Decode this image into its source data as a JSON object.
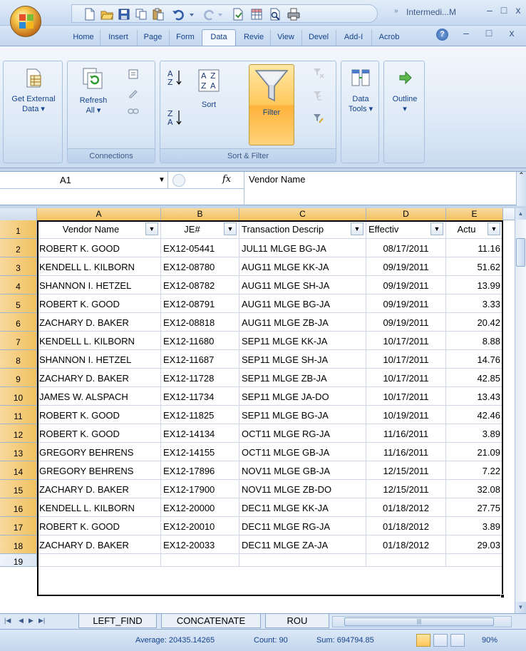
{
  "window": {
    "title": "Intermedi...M",
    "qat_more": "»",
    "min": "–",
    "max": "□",
    "close": "x"
  },
  "ribbon_tabs": [
    "Home",
    "Insert",
    "Page",
    "Form",
    "Data",
    "Revie",
    "View",
    "Devel",
    "Add-I",
    "Acrob"
  ],
  "active_tab": "Data",
  "ribbon": {
    "get_external_data": "Get External",
    "get_external_data_2": "Data",
    "refresh": "Refresh",
    "refresh_2": "All",
    "connections_label": "Connections",
    "sort": "Sort",
    "filter": "Filter",
    "sort_filter_label": "Sort & Filter",
    "data_tools": "Data",
    "data_tools_2": "Tools",
    "outline": "Outline"
  },
  "formula_bar": {
    "name_box": "A1",
    "fx": "fx",
    "value": "Vendor Name"
  },
  "columns": [
    "A",
    "B",
    "C",
    "D",
    "E"
  ],
  "headers": [
    "Vendor Name",
    "JE#",
    "Transaction Descrip",
    "Effectiv",
    "Actu"
  ],
  "rows": [
    [
      "ROBERT K. GOOD",
      "EX12-05441",
      "JUL11 MLGE BG-JA",
      "08/17/2011",
      "11.16"
    ],
    [
      "KENDELL L. KILBORN",
      "EX12-08780",
      "AUG11 MLGE KK-JA",
      "09/19/2011",
      "51.62"
    ],
    [
      "SHANNON I. HETZEL",
      "EX12-08782",
      "AUG11 MLGE SH-JA",
      "09/19/2011",
      "13.99"
    ],
    [
      "ROBERT K. GOOD",
      "EX12-08791",
      "AUG11 MLGE BG-JA",
      "09/19/2011",
      "3.33"
    ],
    [
      "ZACHARY D. BAKER",
      "EX12-08818",
      "AUG11 MLGE ZB-JA",
      "09/19/2011",
      "20.42"
    ],
    [
      "KENDELL L. KILBORN",
      "EX12-11680",
      "SEP11 MLGE KK-JA",
      "10/17/2011",
      "8.88"
    ],
    [
      "SHANNON I. HETZEL",
      "EX12-11687",
      "SEP11 MLGE SH-JA",
      "10/17/2011",
      "14.76"
    ],
    [
      "ZACHARY D. BAKER",
      "EX12-11728",
      "SEP11 MLGE ZB-JA",
      "10/17/2011",
      "42.85"
    ],
    [
      "JAMES W. ALSPACH",
      "EX12-11734",
      "SEP11 MLGE JA-DO",
      "10/17/2011",
      "13.43"
    ],
    [
      "ROBERT K. GOOD",
      "EX12-11825",
      "SEP11 MLGE BG-JA",
      "10/19/2011",
      "42.46"
    ],
    [
      "ROBERT K. GOOD",
      "EX12-14134",
      "OCT11 MLGE RG-JA",
      "11/16/2011",
      "3.89"
    ],
    [
      "GREGORY BEHRENS",
      "EX12-14155",
      "OCT11 MLGE GB-JA",
      "11/16/2011",
      "21.09"
    ],
    [
      "GREGORY BEHRENS",
      "EX12-17896",
      "NOV11 MLGE GB-JA",
      "12/15/2011",
      "7.22"
    ],
    [
      "ZACHARY D. BAKER",
      "EX12-17900",
      "NOV11 MLGE ZB-DO",
      "12/15/2011",
      "32.08"
    ],
    [
      "KENDELL L. KILBORN",
      "EX12-20000",
      "DEC11 MLGE KK-JA",
      "01/18/2012",
      "27.75"
    ],
    [
      "ROBERT K. GOOD",
      "EX12-20010",
      "DEC11 MLGE RG-JA",
      "01/18/2012",
      "3.89"
    ],
    [
      "ZACHARY D. BAKER",
      "EX12-20033",
      "DEC11 MLGE ZA-JA",
      "01/18/2012",
      "29.03"
    ]
  ],
  "row_numbers": [
    "1",
    "2",
    "3",
    "4",
    "5",
    "6",
    "7",
    "8",
    "9",
    "10",
    "11",
    "12",
    "13",
    "14",
    "15",
    "16",
    "17",
    "18",
    "19"
  ],
  "sheet_tabs": [
    "LEFT_FIND",
    "CONCATENATE",
    "ROU"
  ],
  "status": {
    "average": "Average: 20435.14265",
    "count": "Count: 90",
    "sum": "Sum: 694794.85",
    "zoom": "90%"
  }
}
